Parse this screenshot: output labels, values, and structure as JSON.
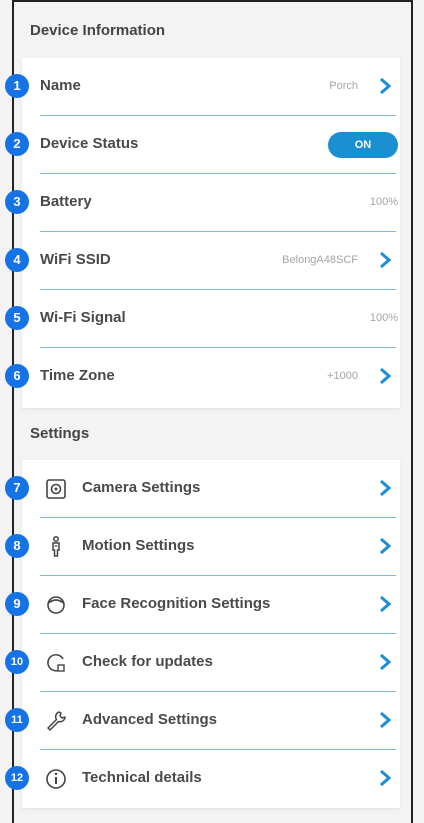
{
  "device_information": {
    "title": "Device Information",
    "rows": [
      {
        "num": "1",
        "label": "Name",
        "value": "Porch"
      },
      {
        "num": "2",
        "label": "Device Status",
        "toggle": "ON"
      },
      {
        "num": "3",
        "label": "Battery",
        "value": "100%"
      },
      {
        "num": "4",
        "label": "WiFi SSID",
        "value": "BelongA48SCF"
      },
      {
        "num": "5",
        "label": "Wi-Fi Signal",
        "value": "100%"
      },
      {
        "num": "6",
        "label": "Time Zone",
        "value": "+1000"
      }
    ]
  },
  "settings": {
    "title": "Settings",
    "rows": [
      {
        "num": "7",
        "label": "Camera Settings",
        "icon": "camera-icon"
      },
      {
        "num": "8",
        "label": "Motion Settings",
        "icon": "motion-person-icon"
      },
      {
        "num": "9",
        "label": "Face Recognition Settings",
        "icon": "face-icon"
      },
      {
        "num": "10",
        "label": "Check for updates",
        "icon": "update-icon"
      },
      {
        "num": "11",
        "label": "Advanced Settings",
        "icon": "wrench-icon"
      },
      {
        "num": "12",
        "label": "Technical details",
        "icon": "info-icon"
      }
    ]
  },
  "colors": {
    "accent": "#1a8fd1",
    "badge": "#1673e6",
    "separator": "#7fb9d8"
  }
}
